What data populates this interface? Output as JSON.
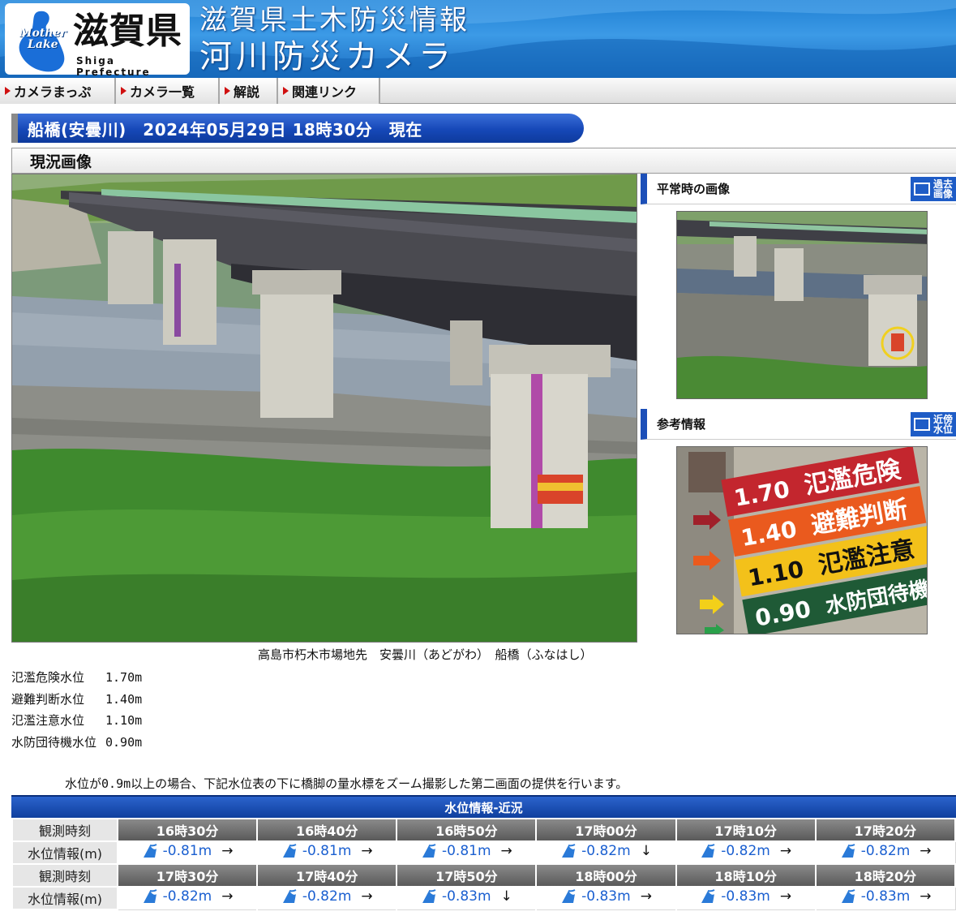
{
  "header": {
    "logo_mother": "Mother",
    "logo_lake": "Lake",
    "logo_pref": "滋賀県",
    "logo_sub": "Shiga Prefecture",
    "title_line1": "滋賀県土木防災情報",
    "title_line2": "河川防災カメラ"
  },
  "nav": {
    "items": [
      {
        "label": "カメラまっぷ"
      },
      {
        "label": "カメラ一覧"
      },
      {
        "label": "解説"
      },
      {
        "label": "関連リンク"
      }
    ]
  },
  "title_bar": "船橋(安曇川)　2024年05月29日 18時30分　現在",
  "current_section": "現況画像",
  "side": {
    "normal_title": "平常時の画像",
    "normal_btn": [
      "過去",
      "画像"
    ],
    "ref_title": "参考情報",
    "ref_btn": [
      "近傍",
      "水位"
    ]
  },
  "gauge_board": [
    {
      "value": "1.70",
      "label": "氾濫危険"
    },
    {
      "value": "1.40",
      "label": "避難判断"
    },
    {
      "value": "1.10",
      "label": "氾濫注意"
    },
    {
      "value": "0.90",
      "label": "水防団待機"
    }
  ],
  "caption": "高島市朽木市場地先　安曇川（あどがわ）　船橋（ふなはし）",
  "levels": [
    {
      "name": "氾濫危険水位",
      "value": "1.70m"
    },
    {
      "name": "避難判断水位",
      "value": "1.40m"
    },
    {
      "name": "氾濫注意水位",
      "value": "1.10m"
    },
    {
      "name": "水防団待機水位",
      "value": "0.90m"
    }
  ],
  "note_a": "水位が",
  "note_b": "0.9m",
  "note_c": "以上の場合、下記水位表の下に橋脚の量水標をズーム撮影した第二画面の提供を行います。",
  "water_table": {
    "title": "水位情報-近況",
    "time_label": "観測時刻",
    "value_label": "水位情報(m)",
    "rows": [
      {
        "times": [
          "16時30分",
          "16時40分",
          "16時50分",
          "17時00分",
          "17時10分",
          "17時20分"
        ],
        "values": [
          "-0.81m",
          "-0.81m",
          "-0.81m",
          "-0.82m",
          "-0.82m",
          "-0.82m"
        ],
        "trends": [
          "→",
          "→",
          "→",
          "↓",
          "→",
          "→"
        ]
      },
      {
        "times": [
          "17時30分",
          "17時40分",
          "17時50分",
          "18時00分",
          "18時10分",
          "18時20分"
        ],
        "values": [
          "-0.82m",
          "-0.82m",
          "-0.83m",
          "-0.83m",
          "-0.83m",
          "-0.83m"
        ],
        "trends": [
          "→",
          "→",
          "↓",
          "→",
          "→",
          "→"
        ]
      }
    ]
  }
}
